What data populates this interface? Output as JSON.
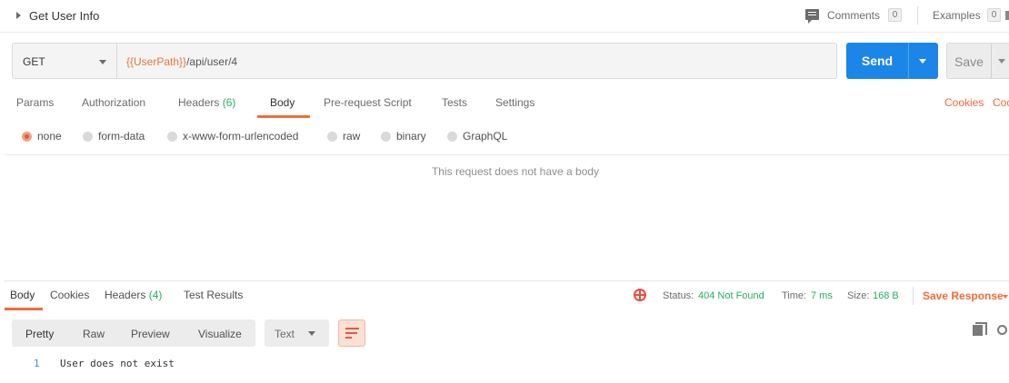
{
  "request": {
    "name": "Get User Info",
    "comments_label": "Comments",
    "comments_count": "0",
    "examples_label": "Examples",
    "examples_count": "0"
  },
  "url_bar": {
    "method": "GET",
    "url_variable": "{{UserPath}}",
    "url_path": "/api/user/4",
    "send_label": "Send",
    "save_label": "Save"
  },
  "request_tabs": {
    "params": "Params",
    "authorization": "Authorization",
    "headers": "Headers",
    "headers_count": "(6)",
    "body": "Body",
    "pre_request_script": "Pre-request Script",
    "tests": "Tests",
    "settings": "Settings",
    "cookies_link": "Cookies",
    "code_link": "Coc"
  },
  "body_types": {
    "selected": "none",
    "options": [
      "none",
      "form-data",
      "x-www-form-urlencoded",
      "raw",
      "binary",
      "GraphQL"
    ]
  },
  "no_body_message": "This request does not have a body",
  "response_tabs": {
    "body": "Body",
    "cookies": "Cookies",
    "headers": "Headers",
    "headers_count": "(4)",
    "test_results": "Test Results"
  },
  "response_status": {
    "status_label": "Status:",
    "status_value": "404 Not Found",
    "time_label": "Time:",
    "time_value": "7 ms",
    "size_label": "Size:",
    "size_value": "168 B",
    "save_response_label": "Save Response"
  },
  "response_toolbar": {
    "views": [
      "Pretty",
      "Raw",
      "Preview",
      "Visualize"
    ],
    "active_view": "Pretty",
    "format": "Text"
  },
  "response_body": {
    "lines": [
      {
        "number": "1",
        "text": "User does not exist"
      }
    ]
  },
  "colors": {
    "accent_orange": "#f26b3a",
    "send_blue": "#1c85e8",
    "success_green": "#27ae60",
    "error_red": "#e74c3c"
  }
}
